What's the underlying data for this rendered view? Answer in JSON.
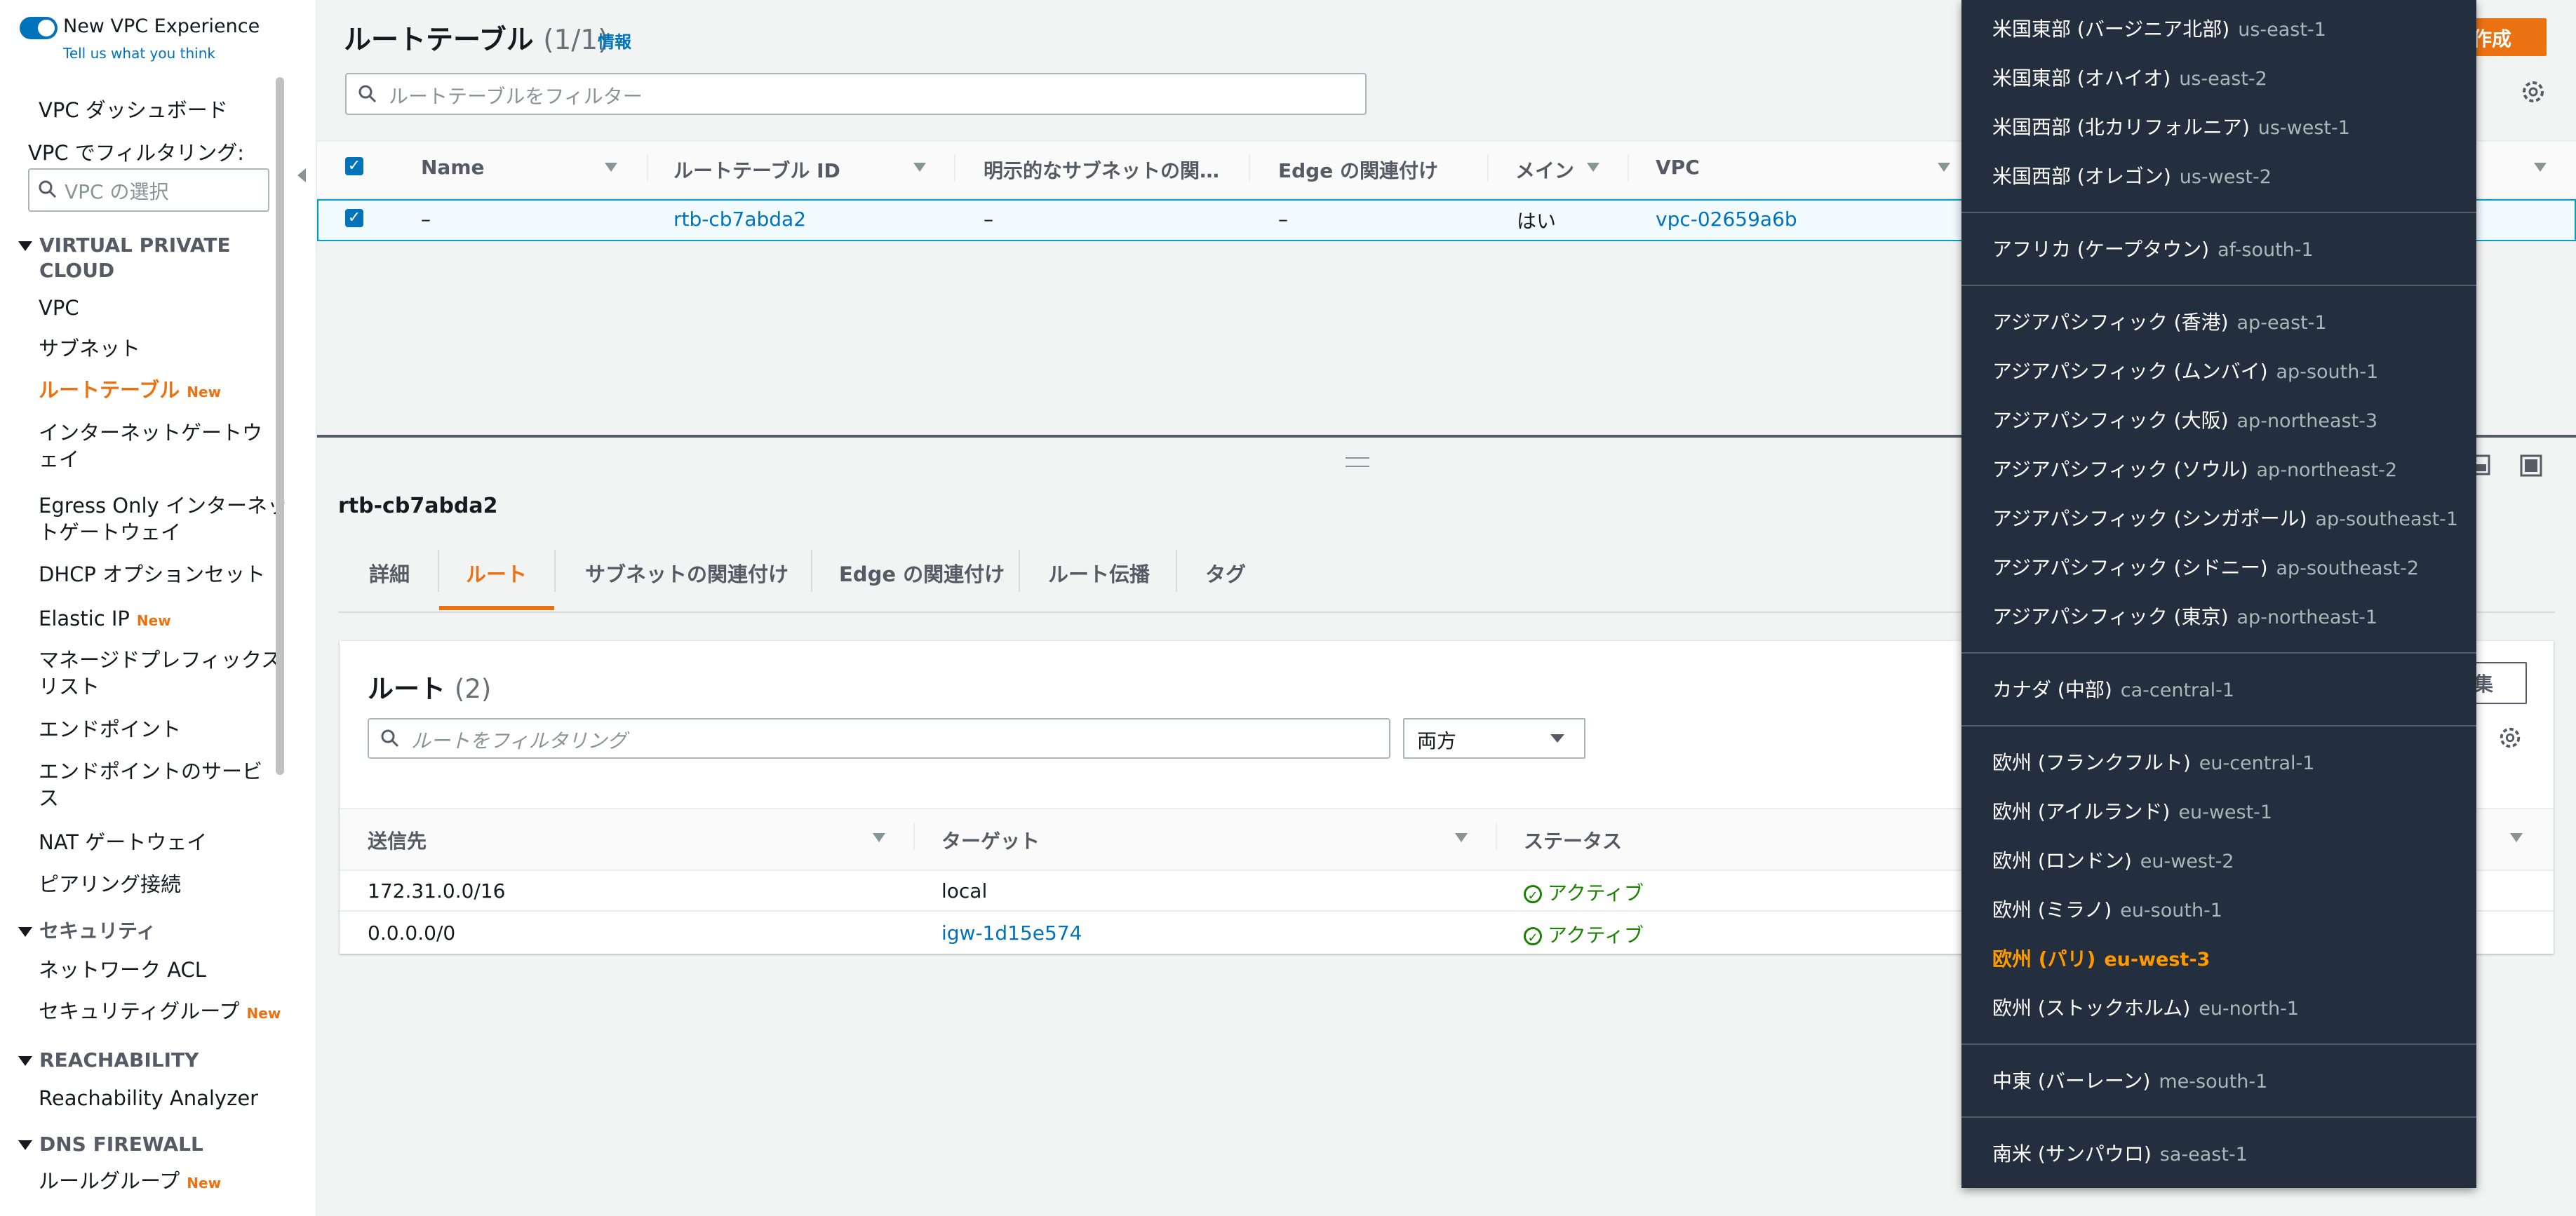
{
  "sidebar": {
    "toggle_label": "New VPC Experience",
    "feedback": "Tell us what you think",
    "dashboard": "VPC ダッシュボード",
    "filter_label": "VPC でフィルタリング:",
    "vpc_select_placeholder": "VPC の選択",
    "sections": [
      {
        "title": "VIRTUAL PRIVATE",
        "title2": "CLOUD"
      },
      {
        "title": "セキュリティ"
      },
      {
        "title": "REACHABILITY"
      },
      {
        "title": "DNS FIREWALL"
      }
    ],
    "items": {
      "vpc": "VPC",
      "subnet": "サブネット",
      "route_table": "ルートテーブル",
      "igw_1": "インターネットゲートウ",
      "igw_2": "ェイ",
      "egress_1": "Egress Only インターネッ",
      "egress_2": "トゲートウェイ",
      "dhcp": "DHCP オプションセット",
      "eip": "Elastic IP",
      "prefix_1": "マネージドプレフィックス",
      "prefix_2": "リスト",
      "endpoint": "エンドポイント",
      "endpoint_svc_1": "エンドポイントのサービ",
      "endpoint_svc_2": "ス",
      "nat": "NAT ゲートウェイ",
      "peering": "ピアリング接続",
      "nacl": "ネットワーク ACL",
      "sg": "セキュリティグループ",
      "analyzer": "Reachability Analyzer",
      "rule_group": "ルールグループ"
    },
    "new_badge": "New"
  },
  "main": {
    "title": "ルートテーブル",
    "count": "(1/1)",
    "info": "情報",
    "create_button": "作成",
    "filter_placeholder": "ルートテーブルをフィルター",
    "columns": [
      "Name",
      "ルートテーブル ID",
      "明示的なサブネットの関…",
      "Edge の関連付け",
      "メイン",
      "VPC"
    ],
    "row": {
      "name": "–",
      "id": "rtb-cb7abda2",
      "subnet": "–",
      "edge": "–",
      "main": "はい",
      "vpc": "vpc-02659a6b"
    }
  },
  "detail": {
    "title": "rtb-cb7abda2",
    "tabs": [
      "詳細",
      "ルート",
      "サブネットの関連付け",
      "Edge の関連付け",
      "ルート伝播",
      "タグ"
    ],
    "routes_title": "ルート",
    "routes_count": "(2)",
    "edit_button": "集",
    "routes_filter_placeholder": "ルートをフィルタリング",
    "select_value": "両方",
    "columns": [
      "送信先",
      "ターゲット",
      "ステータス"
    ],
    "routes": [
      {
        "dest": "172.31.0.0/16",
        "target": "local",
        "status": "アクティブ"
      },
      {
        "dest": "0.0.0.0/0",
        "target": "igw-1d15e574",
        "status": "アクティブ"
      }
    ]
  },
  "regions": [
    {
      "name": "米国東部 (バージニア北部)",
      "code": "us-east-1"
    },
    {
      "name": "米国東部 (オハイオ)",
      "code": "us-east-2"
    },
    {
      "name": "米国西部 (北カリフォルニア)",
      "code": "us-west-1"
    },
    {
      "name": "米国西部 (オレゴン)",
      "code": "us-west-2"
    },
    {
      "name": "アフリカ (ケープタウン)",
      "code": "af-south-1"
    },
    {
      "name": "アジアパシフィック (香港)",
      "code": "ap-east-1"
    },
    {
      "name": "アジアパシフィック (ムンバイ)",
      "code": "ap-south-1"
    },
    {
      "name": "アジアパシフィック (大阪)",
      "code": "ap-northeast-3"
    },
    {
      "name": "アジアパシフィック (ソウル)",
      "code": "ap-northeast-2"
    },
    {
      "name": "アジアパシフィック (シンガポール)",
      "code": "ap-southeast-1"
    },
    {
      "name": "アジアパシフィック (シドニー)",
      "code": "ap-southeast-2"
    },
    {
      "name": "アジアパシフィック (東京)",
      "code": "ap-northeast-1"
    },
    {
      "name": "カナダ (中部)",
      "code": "ca-central-1"
    },
    {
      "name": "欧州 (フランクフルト)",
      "code": "eu-central-1"
    },
    {
      "name": "欧州 (アイルランド)",
      "code": "eu-west-1"
    },
    {
      "name": "欧州 (ロンドン)",
      "code": "eu-west-2"
    },
    {
      "name": "欧州 (ミラノ)",
      "code": "eu-south-1"
    },
    {
      "name": "欧州 (パリ)",
      "code": "eu-west-3",
      "selected": true
    },
    {
      "name": "欧州 (ストックホルム)",
      "code": "eu-north-1"
    },
    {
      "name": "中東 (バーレーン)",
      "code": "me-south-1"
    },
    {
      "name": "南米 (サンパウロ)",
      "code": "sa-east-1"
    }
  ],
  "colors": {
    "accent": "#ec7211",
    "link": "#0073bb",
    "menu_bg": "#232f3e",
    "selected_region": "#ff9900"
  }
}
